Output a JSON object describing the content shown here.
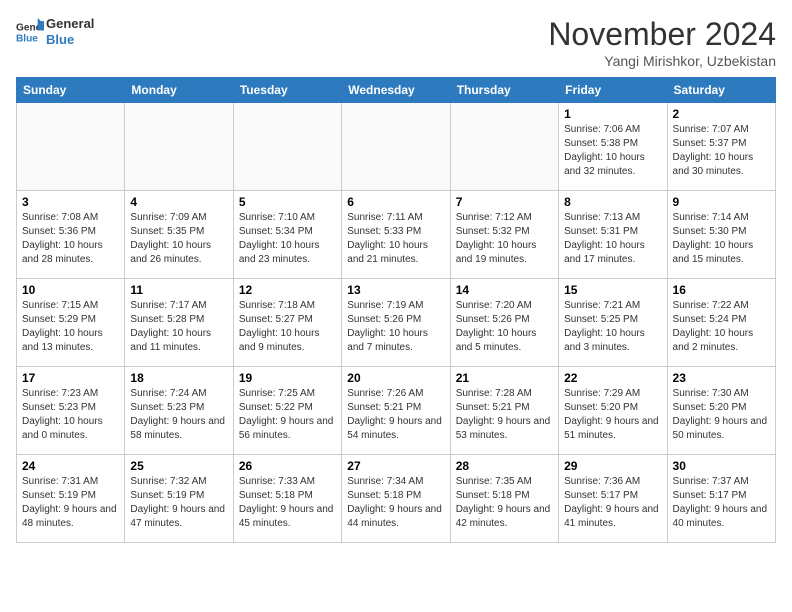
{
  "header": {
    "logo_line1": "General",
    "logo_line2": "Blue",
    "month": "November 2024",
    "location": "Yangi Mirishkor, Uzbekistan"
  },
  "weekdays": [
    "Sunday",
    "Monday",
    "Tuesday",
    "Wednesday",
    "Thursday",
    "Friday",
    "Saturday"
  ],
  "weeks": [
    [
      {
        "day": "",
        "info": ""
      },
      {
        "day": "",
        "info": ""
      },
      {
        "day": "",
        "info": ""
      },
      {
        "day": "",
        "info": ""
      },
      {
        "day": "",
        "info": ""
      },
      {
        "day": "1",
        "info": "Sunrise: 7:06 AM\nSunset: 5:38 PM\nDaylight: 10 hours and 32 minutes."
      },
      {
        "day": "2",
        "info": "Sunrise: 7:07 AM\nSunset: 5:37 PM\nDaylight: 10 hours and 30 minutes."
      }
    ],
    [
      {
        "day": "3",
        "info": "Sunrise: 7:08 AM\nSunset: 5:36 PM\nDaylight: 10 hours and 28 minutes."
      },
      {
        "day": "4",
        "info": "Sunrise: 7:09 AM\nSunset: 5:35 PM\nDaylight: 10 hours and 26 minutes."
      },
      {
        "day": "5",
        "info": "Sunrise: 7:10 AM\nSunset: 5:34 PM\nDaylight: 10 hours and 23 minutes."
      },
      {
        "day": "6",
        "info": "Sunrise: 7:11 AM\nSunset: 5:33 PM\nDaylight: 10 hours and 21 minutes."
      },
      {
        "day": "7",
        "info": "Sunrise: 7:12 AM\nSunset: 5:32 PM\nDaylight: 10 hours and 19 minutes."
      },
      {
        "day": "8",
        "info": "Sunrise: 7:13 AM\nSunset: 5:31 PM\nDaylight: 10 hours and 17 minutes."
      },
      {
        "day": "9",
        "info": "Sunrise: 7:14 AM\nSunset: 5:30 PM\nDaylight: 10 hours and 15 minutes."
      }
    ],
    [
      {
        "day": "10",
        "info": "Sunrise: 7:15 AM\nSunset: 5:29 PM\nDaylight: 10 hours and 13 minutes."
      },
      {
        "day": "11",
        "info": "Sunrise: 7:17 AM\nSunset: 5:28 PM\nDaylight: 10 hours and 11 minutes."
      },
      {
        "day": "12",
        "info": "Sunrise: 7:18 AM\nSunset: 5:27 PM\nDaylight: 10 hours and 9 minutes."
      },
      {
        "day": "13",
        "info": "Sunrise: 7:19 AM\nSunset: 5:26 PM\nDaylight: 10 hours and 7 minutes."
      },
      {
        "day": "14",
        "info": "Sunrise: 7:20 AM\nSunset: 5:26 PM\nDaylight: 10 hours and 5 minutes."
      },
      {
        "day": "15",
        "info": "Sunrise: 7:21 AM\nSunset: 5:25 PM\nDaylight: 10 hours and 3 minutes."
      },
      {
        "day": "16",
        "info": "Sunrise: 7:22 AM\nSunset: 5:24 PM\nDaylight: 10 hours and 2 minutes."
      }
    ],
    [
      {
        "day": "17",
        "info": "Sunrise: 7:23 AM\nSunset: 5:23 PM\nDaylight: 10 hours and 0 minutes."
      },
      {
        "day": "18",
        "info": "Sunrise: 7:24 AM\nSunset: 5:23 PM\nDaylight: 9 hours and 58 minutes."
      },
      {
        "day": "19",
        "info": "Sunrise: 7:25 AM\nSunset: 5:22 PM\nDaylight: 9 hours and 56 minutes."
      },
      {
        "day": "20",
        "info": "Sunrise: 7:26 AM\nSunset: 5:21 PM\nDaylight: 9 hours and 54 minutes."
      },
      {
        "day": "21",
        "info": "Sunrise: 7:28 AM\nSunset: 5:21 PM\nDaylight: 9 hours and 53 minutes."
      },
      {
        "day": "22",
        "info": "Sunrise: 7:29 AM\nSunset: 5:20 PM\nDaylight: 9 hours and 51 minutes."
      },
      {
        "day": "23",
        "info": "Sunrise: 7:30 AM\nSunset: 5:20 PM\nDaylight: 9 hours and 50 minutes."
      }
    ],
    [
      {
        "day": "24",
        "info": "Sunrise: 7:31 AM\nSunset: 5:19 PM\nDaylight: 9 hours and 48 minutes."
      },
      {
        "day": "25",
        "info": "Sunrise: 7:32 AM\nSunset: 5:19 PM\nDaylight: 9 hours and 47 minutes."
      },
      {
        "day": "26",
        "info": "Sunrise: 7:33 AM\nSunset: 5:18 PM\nDaylight: 9 hours and 45 minutes."
      },
      {
        "day": "27",
        "info": "Sunrise: 7:34 AM\nSunset: 5:18 PM\nDaylight: 9 hours and 44 minutes."
      },
      {
        "day": "28",
        "info": "Sunrise: 7:35 AM\nSunset: 5:18 PM\nDaylight: 9 hours and 42 minutes."
      },
      {
        "day": "29",
        "info": "Sunrise: 7:36 AM\nSunset: 5:17 PM\nDaylight: 9 hours and 41 minutes."
      },
      {
        "day": "30",
        "info": "Sunrise: 7:37 AM\nSunset: 5:17 PM\nDaylight: 9 hours and 40 minutes."
      }
    ]
  ]
}
